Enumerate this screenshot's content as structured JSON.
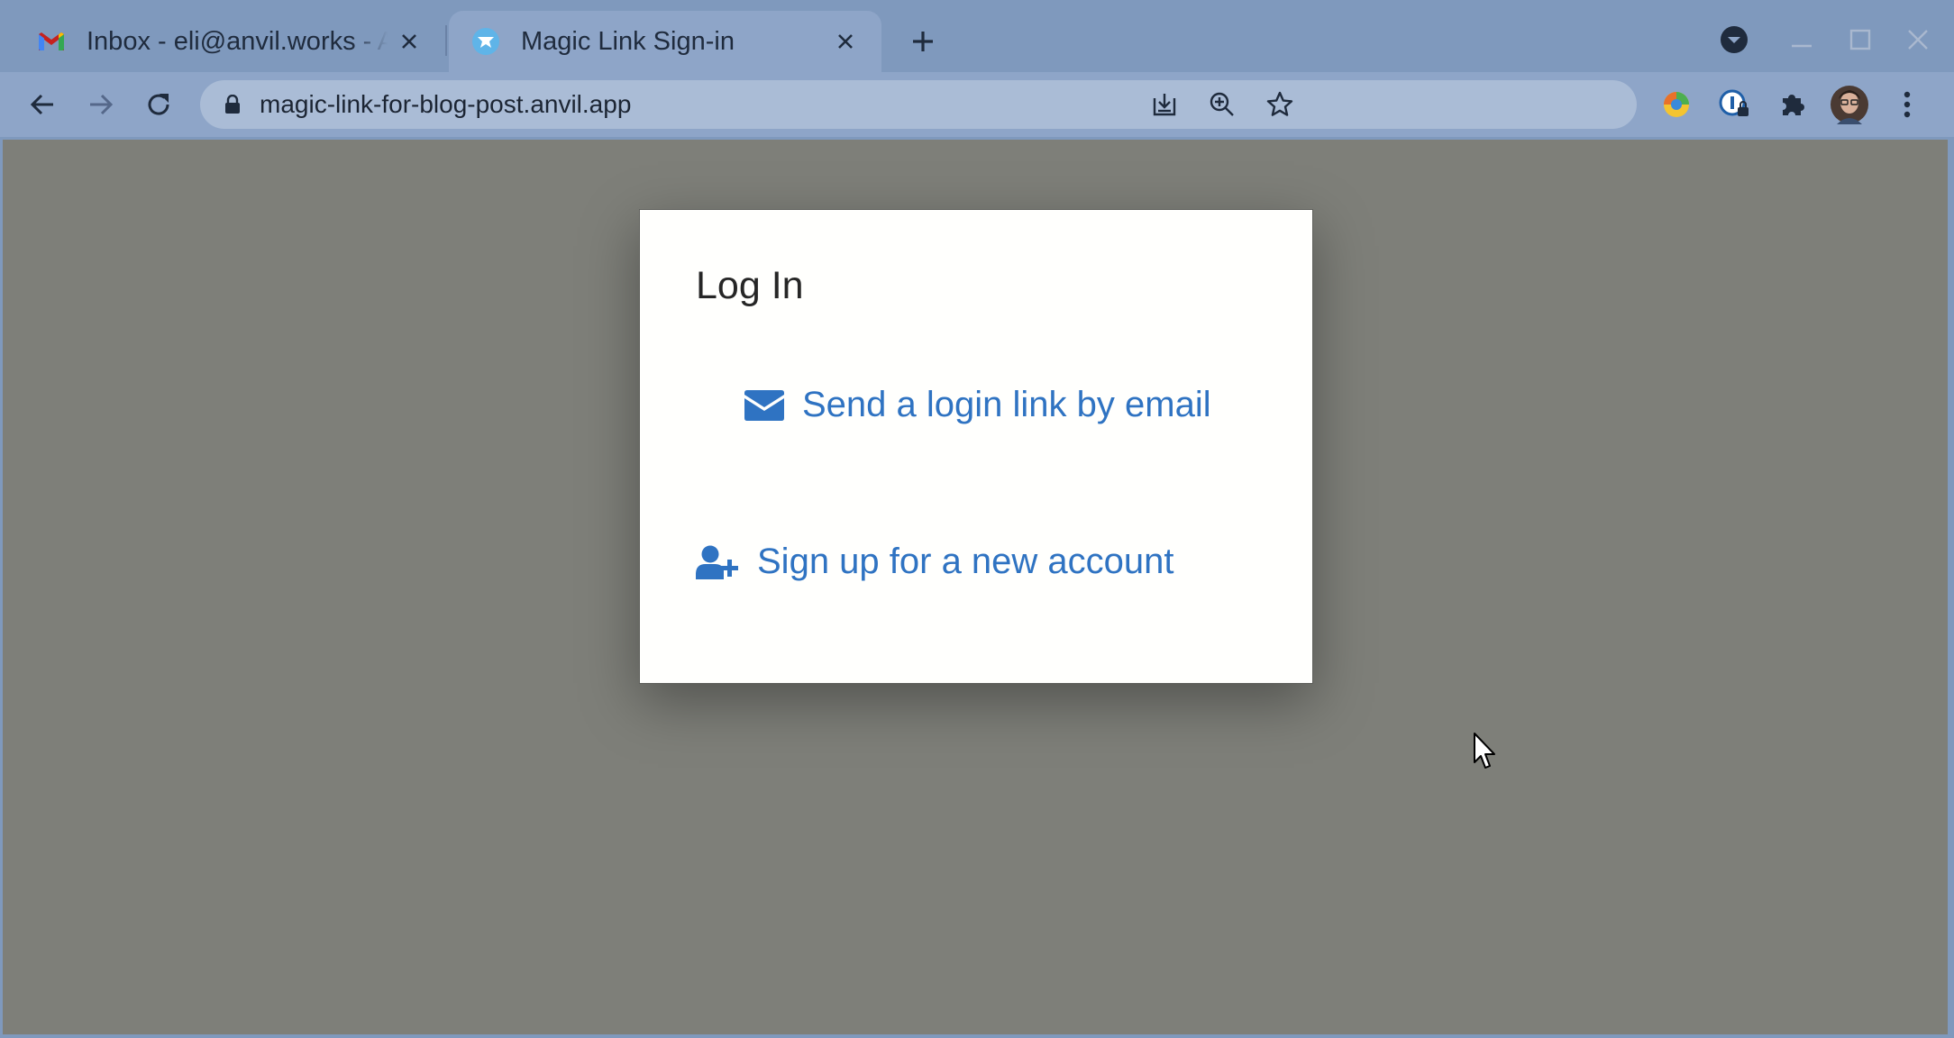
{
  "browser": {
    "tabs": [
      {
        "title": "Inbox - eli@anvil.works - Anvil Mail",
        "favicon": "gmail-icon",
        "active": false
      },
      {
        "title": "Magic Link Sign-in",
        "favicon": "anvil-icon",
        "active": true
      }
    ],
    "address_bar": {
      "url": "magic-link-for-blog-post.anvil.app"
    }
  },
  "dialog": {
    "title": "Log In",
    "email_link_label": "Send a login link by email",
    "email_icon": "envelope-icon",
    "signup_link_label": "Sign up for a new account",
    "signup_icon": "user-plus-icon"
  },
  "colors": {
    "link": "#2f73c2",
    "page_backdrop": "#7e7f79",
    "browser_frame": "#7f99bd"
  }
}
